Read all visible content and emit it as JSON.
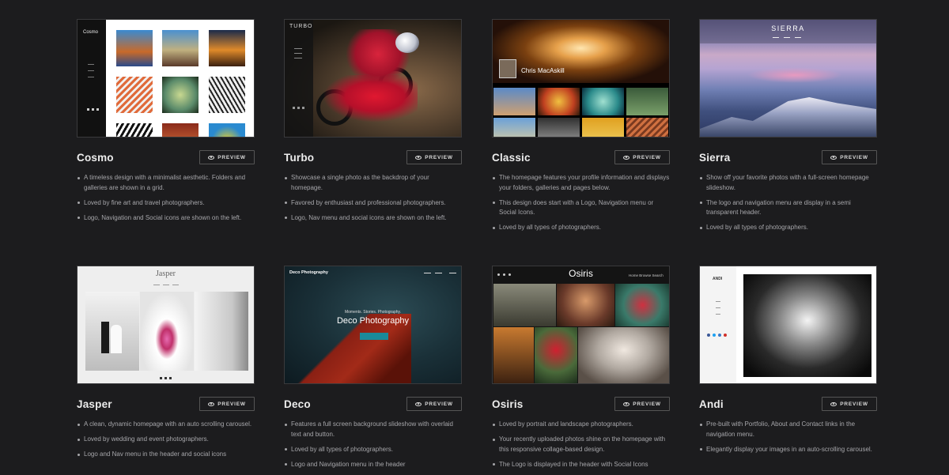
{
  "preview_label": "PREVIEW",
  "themes": [
    {
      "name": "Cosmo",
      "thumb_logo": "Cosmo",
      "bullets": [
        "A timeless design with a minimalist aesthetic. Folders and galleries are shown in a grid.",
        "Loved by fine art and travel photographers.",
        "Logo, Navigation and Social icons are shown on the left."
      ]
    },
    {
      "name": "Turbo",
      "thumb_logo": "TURBO",
      "bullets": [
        "Showcase a single photo as the backdrop of your homepage.",
        "Favored by enthusiast and professional photographers.",
        "Logo, Nav menu and social icons are shown on the left."
      ]
    },
    {
      "name": "Classic",
      "thumb_logo": "Chris MacAskill",
      "bullets": [
        "The homepage features your profile information and displays your folders, galleries and pages below.",
        "This design does start with a Logo, Navigation menu or Social Icons.",
        "Loved by all types of photographers."
      ]
    },
    {
      "name": "Sierra",
      "thumb_logo": "SIERRA",
      "bullets": [
        "Show off your favorite photos with a full-screen homepage slideshow.",
        "The logo and navigation menu are display in a semi transparent header.",
        "Loved by all types of photographers."
      ]
    },
    {
      "name": "Jasper",
      "thumb_logo": "Jasper",
      "bullets": [
        "A clean, dynamic homepage with an auto scrolling carousel.",
        "Loved by wedding and event photographers.",
        "Logo and Nav menu in the header and social icons"
      ]
    },
    {
      "name": "Deco",
      "thumb_logo": "Deco Photography",
      "thumb_sub": "Moments. Stories. Photography.",
      "thumb_big": "Deco Photography",
      "bullets": [
        "Features a full screen background slideshow with overlaid text and button.",
        "Loved by all types of photographers.",
        "Logo and Navigation menu in the header"
      ]
    },
    {
      "name": "Osiris",
      "thumb_logo": "Osiris",
      "thumb_menu": "Home  Browse  Search",
      "bullets": [
        "Loved by portrait and landscape photographers.",
        "Your recently uploaded photos shine on the homepage with this responsive collage-based design.",
        "The Logo is displayed in the header with Social Icons"
      ]
    },
    {
      "name": "Andi",
      "thumb_logo": "ANDI",
      "bullets": [
        "Pre-built with Portfolio, About and Contact links in the navigation menu.",
        "Elegantly display your images in an auto-scrolling carousel."
      ]
    }
  ]
}
